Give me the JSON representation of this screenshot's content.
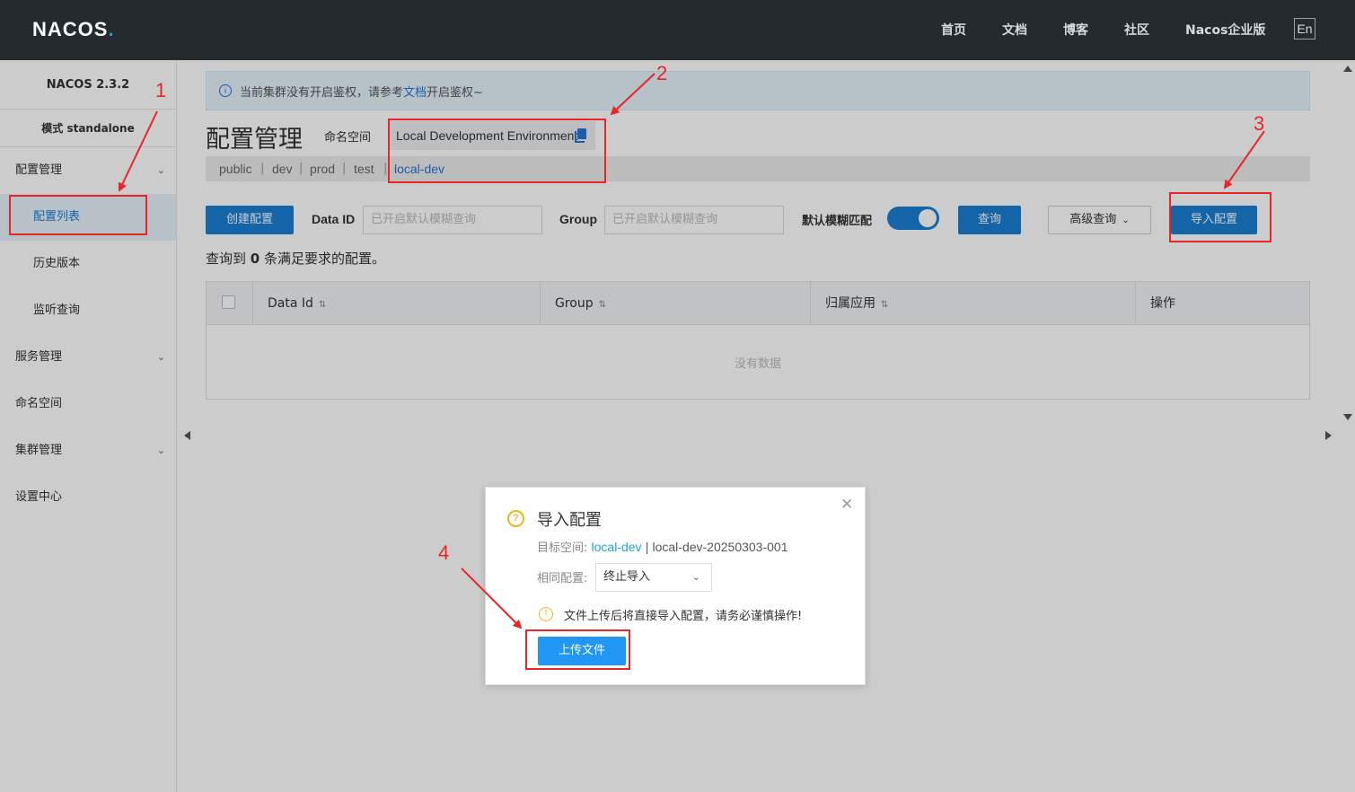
{
  "topbar": {
    "logo_text": "NACOS",
    "logo_dot": ".",
    "nav": [
      "首页",
      "文档",
      "博客",
      "社区",
      "Nacos企业版"
    ],
    "lang": "En"
  },
  "sidebar": {
    "version": "NACOS 2.3.2",
    "mode": "模式 standalone",
    "items": [
      {
        "label": "配置管理"
      },
      {
        "label": "配置列表"
      },
      {
        "label": "历史版本"
      },
      {
        "label": "监听查询"
      },
      {
        "label": "服务管理"
      },
      {
        "label": "命名空间"
      },
      {
        "label": "集群管理"
      },
      {
        "label": "设置中心"
      }
    ]
  },
  "notice": {
    "prefix": "当前集群没有开启鉴权，请参考",
    "link": "文档",
    "suffix": "开启鉴权~"
  },
  "page": {
    "title": "配置管理",
    "ns_label": "命名空间",
    "ns_name": "Local Development Environment",
    "ns_tabs": [
      "public",
      "dev",
      "prod",
      "test",
      "local-dev"
    ],
    "active_tab": "local-dev"
  },
  "toolbar": {
    "create_btn": "创建配置",
    "dataid_label": "Data ID",
    "dataid_placeholder": "已开启默认模糊查询",
    "group_label": "Group",
    "group_placeholder": "已开启默认模糊查询",
    "fuzzy_label": "默认模糊匹配",
    "fuzzy_on": true,
    "query_btn": "查询",
    "advanced_btn": "高级查询",
    "import_btn": "导入配置"
  },
  "result": {
    "prefix": "查询到",
    "count": "0",
    "suffix": "条满足要求的配置。"
  },
  "table": {
    "columns": [
      "Data Id",
      "Group",
      "归属应用",
      "操作"
    ],
    "empty": "没有数据"
  },
  "dialog": {
    "title": "导入配置",
    "target_label": "目标空间:",
    "target_ns": "local-dev",
    "target_sep": "|",
    "target_id": "local-dev-20250303-001",
    "same_label": "相同配置:",
    "same_value": "终止导入",
    "warning": "文件上传后将直接导入配置，请务必谨慎操作!",
    "upload_btn": "上传文件"
  },
  "annotations": [
    "1",
    "2",
    "3",
    "4"
  ],
  "colors": {
    "topbar": "#252a2f",
    "primary": "#1a7ed3",
    "annotation": "#e8262a",
    "warning": "#f0b41c"
  }
}
